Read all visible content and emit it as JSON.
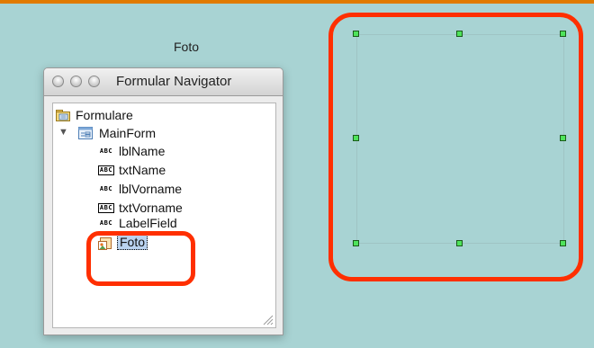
{
  "colors": {
    "background": "#a8d3d3",
    "top_accent": "#e07a00",
    "highlight_frame": "#ff2f00",
    "handle_fill": "#4ee35b"
  },
  "canvas": {
    "caption": "Foto"
  },
  "navigator": {
    "title": "Formular Navigator",
    "root": {
      "label": "Formulare",
      "icon": "forms-folder-icon"
    },
    "form": {
      "label": "MainForm",
      "icon": "form-icon",
      "expanded": true
    },
    "controls": [
      {
        "label": "lblName",
        "icon": "label-field-icon"
      },
      {
        "label": "txtName",
        "icon": "text-box-icon"
      },
      {
        "label": "lblVorname",
        "icon": "label-field-icon"
      },
      {
        "label": "txtVorname",
        "icon": "text-box-icon"
      },
      {
        "label": "LabelField",
        "icon": "label-field-icon"
      },
      {
        "label": "Foto",
        "icon": "image-control-icon",
        "selected": true
      }
    ],
    "abc_glyph": "ABC",
    "disclosure_glyph": "▼"
  }
}
